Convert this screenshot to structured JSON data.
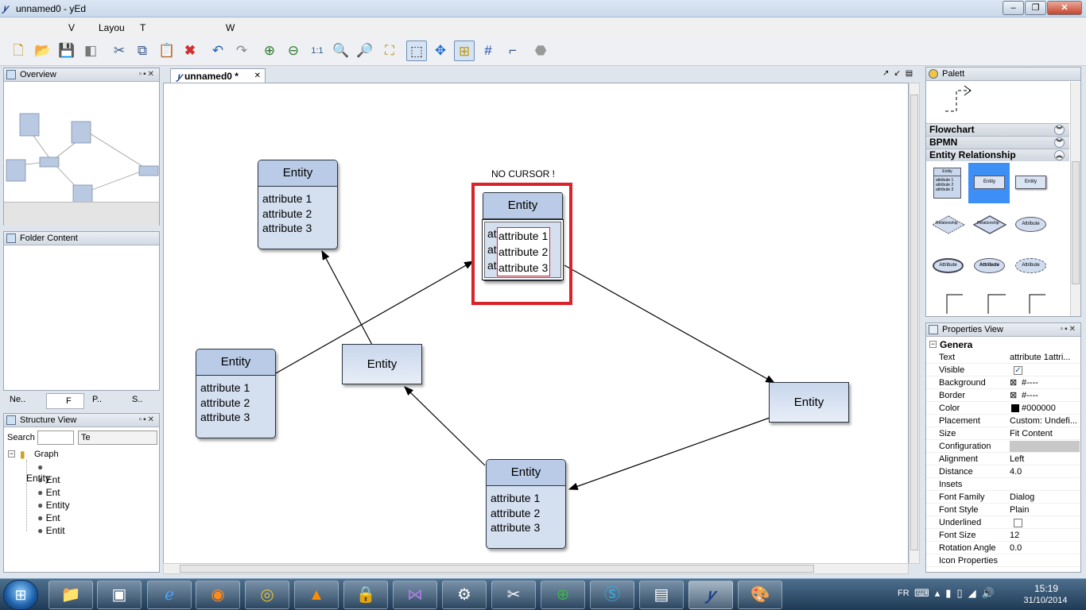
{
  "window": {
    "title": "unnamed0 - yEd"
  },
  "menu": [
    "V",
    "Layou",
    "T",
    "W"
  ],
  "tab": {
    "label": "unnamed0 *"
  },
  "panels": {
    "overview": "Overview",
    "folder": "Folder Content",
    "tabs": [
      "Ne..",
      "F",
      "P..",
      "S.."
    ],
    "structure": "Structure View",
    "palette": "Palett",
    "properties": "Properties View"
  },
  "structure": {
    "search_label": "Search",
    "search_value": "Te",
    "root": "Graph",
    "items": [
      "Entity",
      "Ent",
      "Ent",
      "Entity",
      "Ent",
      "Entit"
    ]
  },
  "diagram": {
    "annotation": "NO CURSOR !",
    "entity_label": "Entity",
    "attributes": [
      "attribute 1",
      "attribute 2",
      "attribute 3"
    ],
    "editing_prefix": [
      "att",
      "att",
      "at"
    ]
  },
  "palette": {
    "categories": [
      "Flowchart",
      "BPMN",
      "Entity Relationship"
    ],
    "er_items": [
      "Entity",
      "Entity",
      "Entity",
      "Relationship",
      "Relationship",
      "Attribute",
      "Attribute",
      "Attribute",
      "Attribute"
    ],
    "er_mini_attrs": [
      "attribute 1",
      "attribute 2",
      "attribute 3"
    ]
  },
  "properties": {
    "section": "Genera",
    "rows": [
      {
        "key": "Text",
        "value": "attribute 1attri..."
      },
      {
        "key": "Visible",
        "value": ""
      },
      {
        "key": "Background",
        "value": "#----"
      },
      {
        "key": "Border",
        "value": "#----"
      },
      {
        "key": "Color",
        "value": "#000000"
      },
      {
        "key": "Placement",
        "value": "Custom: Undefi..."
      },
      {
        "key": "Size",
        "value": "Fit Content"
      },
      {
        "key": "Configuration",
        "value": ""
      },
      {
        "key": "Alignment",
        "value": "Left"
      },
      {
        "key": "Distance",
        "value": "4.0"
      },
      {
        "key": "Insets",
        "value": ""
      },
      {
        "key": "Font Family",
        "value": "Dialog"
      },
      {
        "key": "Font Style",
        "value": "Plain"
      },
      {
        "key": "Underlined",
        "value": ""
      },
      {
        "key": "Font Size",
        "value": "12"
      },
      {
        "key": "Rotation Angle",
        "value": "0.0"
      },
      {
        "key": "Icon Properties",
        "value": ""
      }
    ]
  },
  "taskbar": {
    "lang": "FR",
    "time": "15:19",
    "date": "31/10/2014"
  },
  "colors": {
    "highlight": "#d9232b",
    "node_fill": "#d4dff0",
    "node_header": "#b9cbe6",
    "palette_selected": "#3d8ef5"
  }
}
